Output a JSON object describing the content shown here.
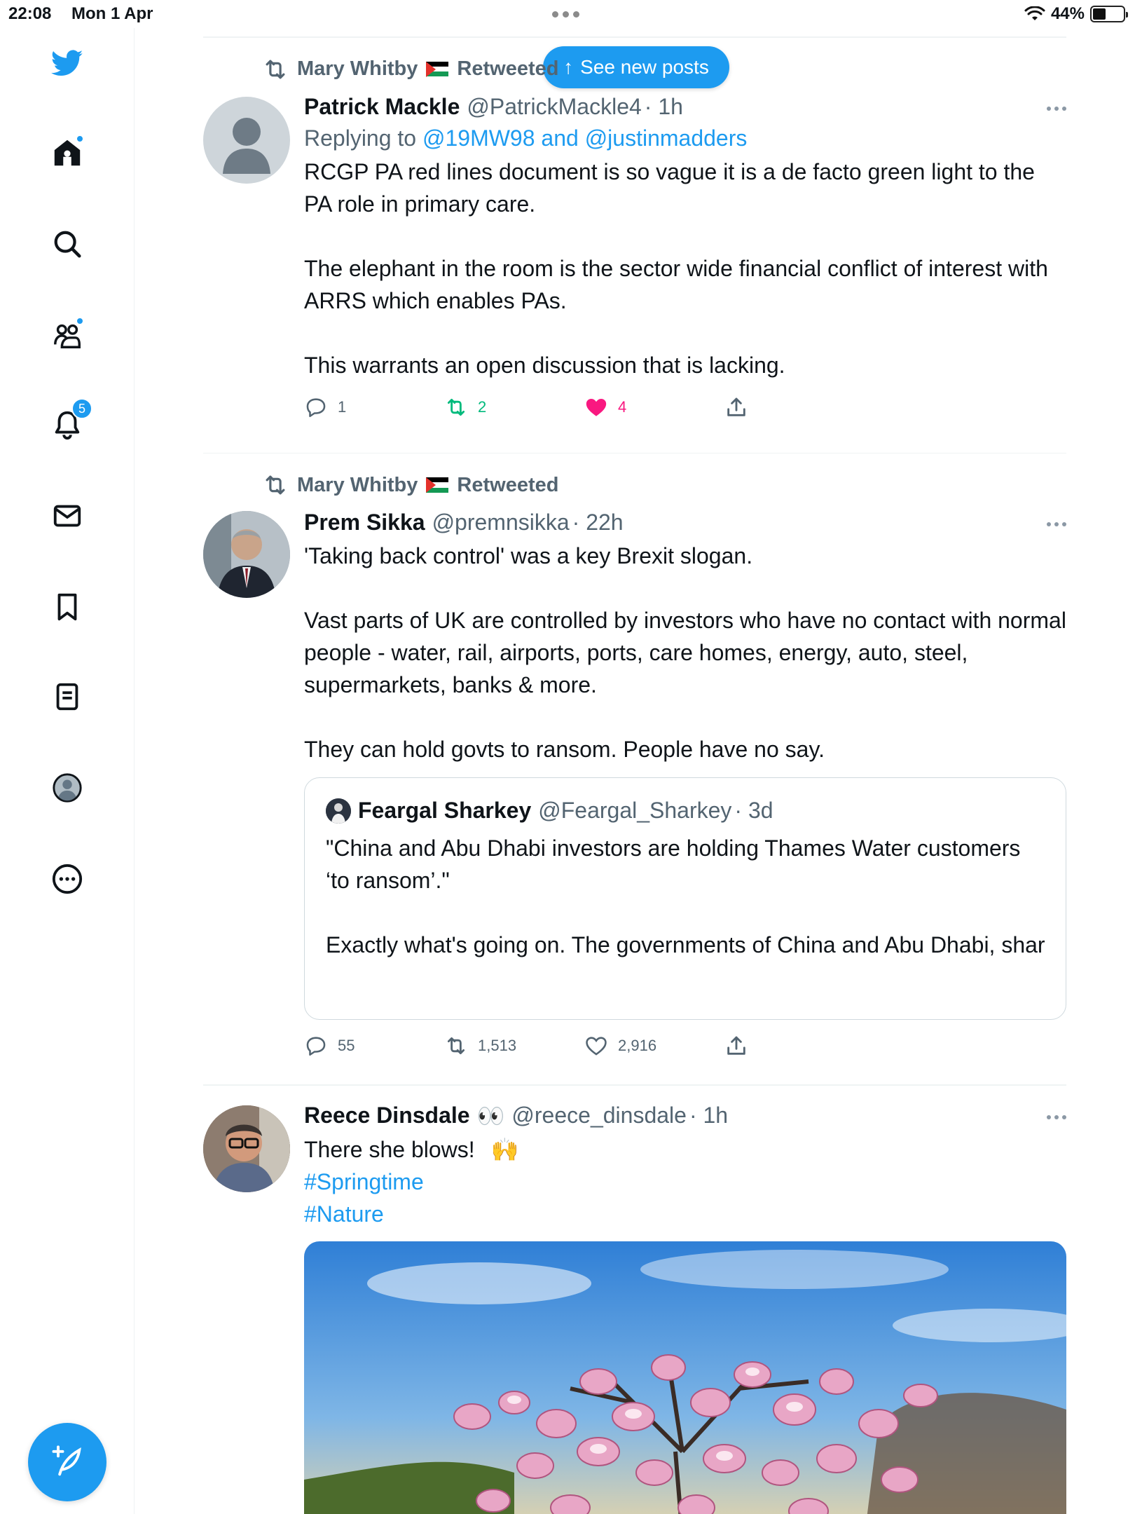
{
  "status_bar": {
    "time": "22:08",
    "date": "Mon 1 Apr",
    "battery": "44%",
    "battery_level": 0.44
  },
  "sidebar": {
    "notification_count": "5"
  },
  "new_posts_pill": {
    "label": "See new posts",
    "arrow": "↑"
  },
  "tweets": [
    {
      "retweeted_by": "Mary Whitby",
      "retweet_label": "Retweeted",
      "name": "Patrick Mackle",
      "handle": "@PatrickMackle4",
      "time": "· 1h",
      "replying_prefix": "Replying to",
      "replying_to": "@19MW98 and @justinmadders",
      "body": [
        "RCGP PA red lines document is so vague it is a de facto green light to the PA role in primary care.",
        "",
        "The elephant in the room is the sector wide financial conflict of interest with ARRS which enables PAs.",
        "",
        "This warrants an open discussion that is lacking."
      ],
      "replies": "1",
      "retweets": "2",
      "likes": "4",
      "colors": {
        "retweet": "#00ba7c",
        "like": "#f91880"
      }
    },
    {
      "retweeted_by": "Mary Whitby",
      "retweet_label": "Retweeted",
      "name": "Prem Sikka",
      "handle": "@premnsikka",
      "time": "· 22h",
      "body": [
        "'Taking back control' was a key Brexit slogan.",
        "",
        "Vast parts of UK are controlled by investors who have no contact with normal people - water, rail, airports, ports, care homes, energy, auto, steel, supermarkets, banks & more.",
        "",
        "They can hold govts to ransom. People have no say."
      ],
      "quote": {
        "name": "Feargal Sharkey",
        "handle": "@Feargal_Sharkey",
        "time": "· 3d",
        "body": [
          "\"China and Abu Dhabi investors are holding Thames Water customers ‘to ransom’.\"",
          "",
          "Exactly what's going on. The governments of China and Abu Dhabi, shareholders of @Thameswater have fleeced customers for billion..."
        ]
      },
      "replies": "55",
      "retweets": "1,513",
      "likes": "2,916"
    },
    {
      "name": "Reece Dinsdale",
      "name_emoji": "👀",
      "handle": "@reece_dinsdale",
      "time": "· 1h",
      "body_text": "There she blows!",
      "body_emoji": "🙌",
      "hashtags": [
        "#Springtime",
        "#Nature"
      ]
    }
  ]
}
